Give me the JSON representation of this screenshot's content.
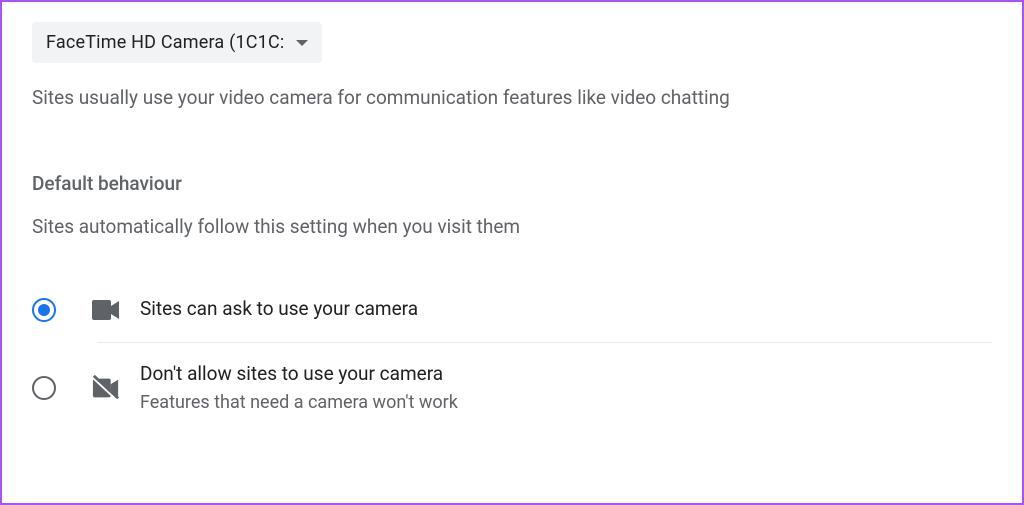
{
  "camera_select": {
    "selected_label": "FaceTime HD Camera (1C1C:"
  },
  "description": "Sites usually use your video camera for communication features like video chatting",
  "section": {
    "heading": "Default behaviour",
    "subtext": "Sites automatically follow this setting when you visit them"
  },
  "options": {
    "allow": {
      "label": "Sites can ask to use your camera",
      "selected": true
    },
    "block": {
      "label": "Don't allow sites to use your camera",
      "sublabel": "Features that need a camera won't work",
      "selected": false
    }
  }
}
